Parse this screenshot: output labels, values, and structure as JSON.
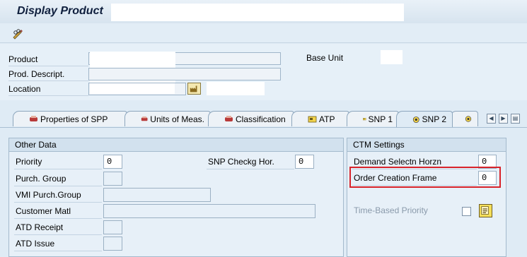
{
  "window": {
    "title": "Display Product"
  },
  "toolbar": {
    "display_change_icon": "pencil-glasses-icon"
  },
  "header": {
    "product_label": "Product",
    "description_label": "Prod. Descript.",
    "location_label": "Location",
    "base_unit_label": "Base Unit"
  },
  "tabs": [
    {
      "label": "Properties of SPP",
      "icon": "spp-icon"
    },
    {
      "label": "Units of Meas.",
      "icon": "units-icon"
    },
    {
      "label": "Classification",
      "icon": "classification-icon"
    },
    {
      "label": "ATP",
      "icon": "atp-icon"
    },
    {
      "label": "SNP 1",
      "icon": "snp-icon"
    },
    {
      "label": "SNP 2",
      "icon": "snp-target-icon",
      "active": true
    }
  ],
  "other_data": {
    "header": "Other Data",
    "priority_label": "Priority",
    "priority_value": "0",
    "snp_checkg_hor_label": "SNP Checkg Hor.",
    "snp_checkg_hor_value": "0",
    "purch_group_label": "Purch. Group",
    "purch_group_value": "",
    "vmi_purch_group_label": "VMI Purch.Group",
    "vmi_purch_group_value": "",
    "customer_matl_label": "Customer Matl",
    "customer_matl_value": "",
    "atd_receipt_label": "ATD Receipt",
    "atd_receipt_value": "",
    "atd_issue_label": "ATD Issue",
    "atd_issue_value": ""
  },
  "ctm_settings": {
    "header": "CTM Settings",
    "demand_selectn_horzn_label": "Demand Selectn Horzn",
    "demand_selectn_horzn_value": "0",
    "order_creation_frame_label": "Order Creation Frame",
    "order_creation_frame_value": "0",
    "time_based_priority_label": "Time-Based Priority"
  },
  "colors": {
    "highlight": "#d8232a",
    "background": "#dfebf5"
  }
}
